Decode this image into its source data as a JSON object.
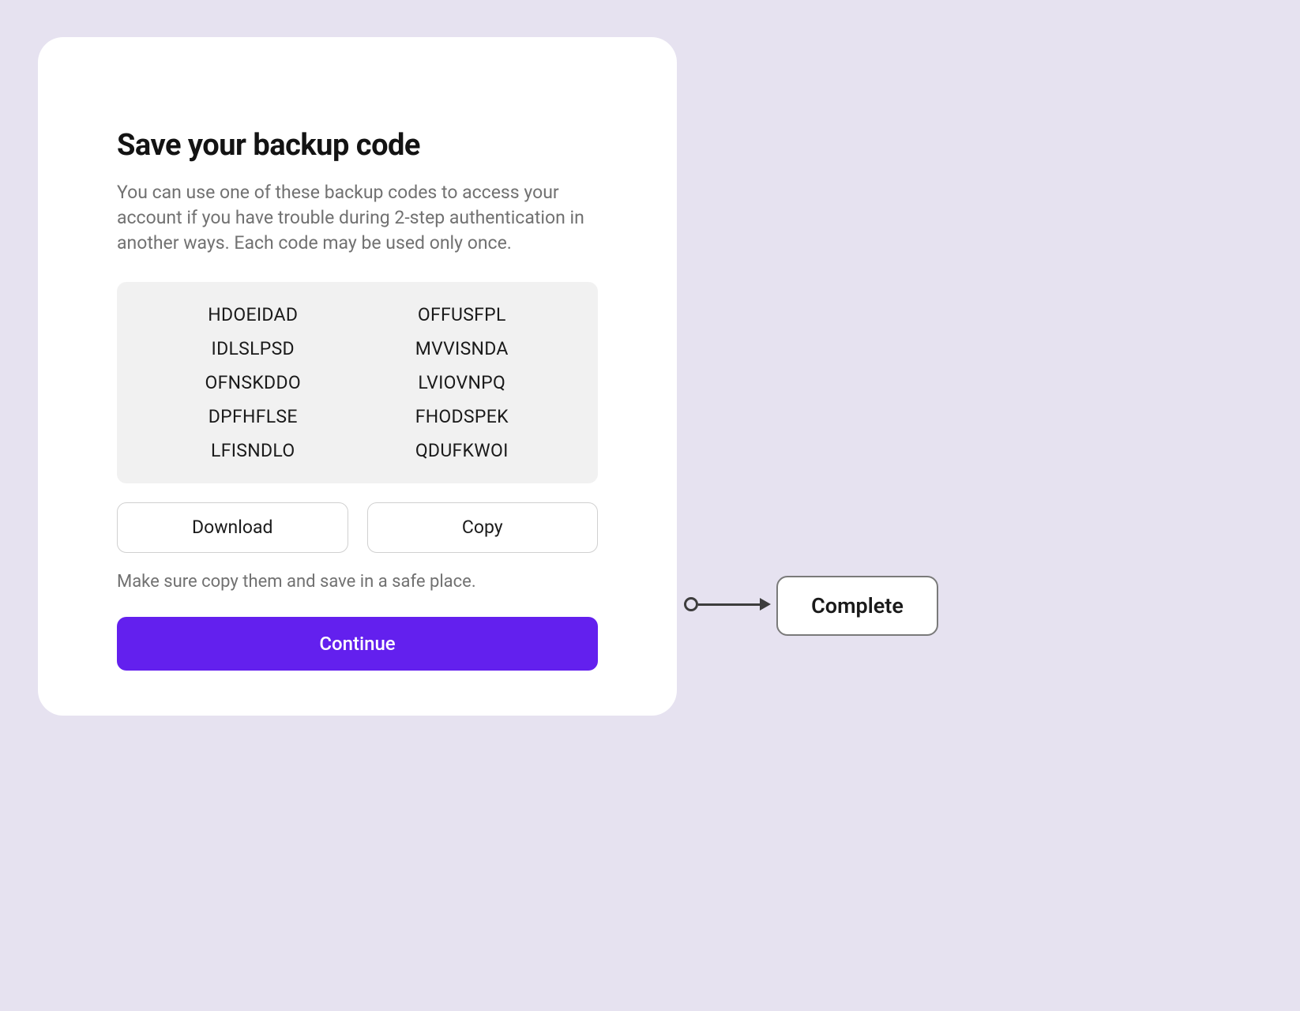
{
  "card": {
    "title": "Save your backup code",
    "description": "You can use one of these backup codes to access your account if you have trouble during 2-step authentication in another ways. Each code may be used only once.",
    "codes_left": [
      "HDOEIDAD",
      "IDLSLPSD",
      "OFNSKDDO",
      "DPFHFLSE",
      "LFISNDLO"
    ],
    "codes_right": [
      "OFFUSFPL",
      "MVVISNDA",
      "LVIOVNPQ",
      "FHODSPEK",
      "QDUFKWOI"
    ],
    "download_label": "Download",
    "copy_label": "Copy",
    "hint": "Make sure copy them and save in a safe place.",
    "continue_label": "Continue"
  },
  "annotation": {
    "complete_label": "Complete"
  }
}
